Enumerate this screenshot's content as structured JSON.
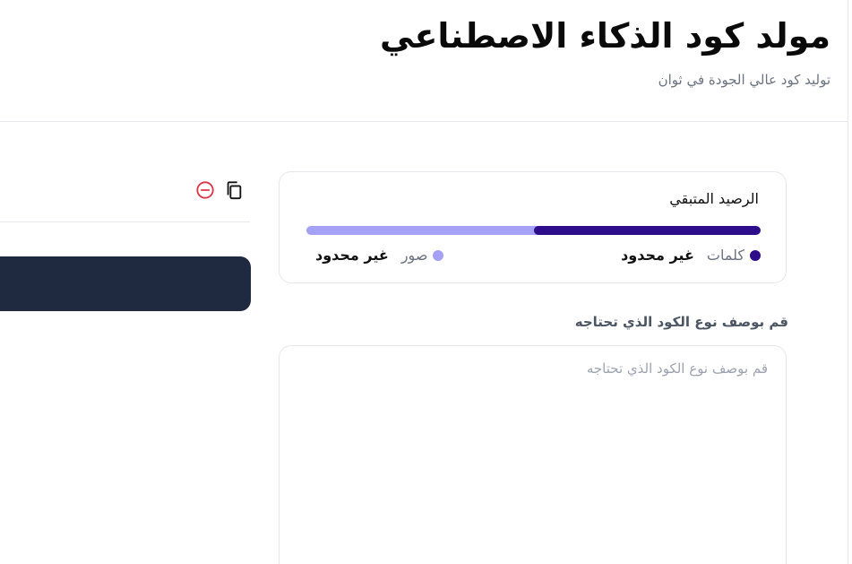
{
  "header": {
    "title": "مولد كود الذكاء الاصطناعي",
    "subtitle": "توليد كود عالي الجودة في ثوان"
  },
  "credits": {
    "title": "الرصيد المتبقي",
    "words_fraction": 0.5,
    "words": {
      "label": "كلمات",
      "value": "غير محدود",
      "color": "#2e0d8a"
    },
    "images": {
      "label": "صور",
      "value": "غير محدود",
      "color": "#a5a1f7"
    }
  },
  "prompt": {
    "label": "قم بوصف نوع الكود الذي تحتاجه",
    "placeholder": "قم بوصف نوع الكود الذي تحتاجه",
    "value": ""
  },
  "output": {
    "toolbar": {
      "copy_icon": "copy-icon",
      "clear_icon": "minus-circle-icon"
    },
    "code": ""
  },
  "colors": {
    "accent": "#2e0d8a",
    "accent_light": "#a5a1f7",
    "danger": "#dc3545",
    "code_bg": "#1f2a40"
  }
}
